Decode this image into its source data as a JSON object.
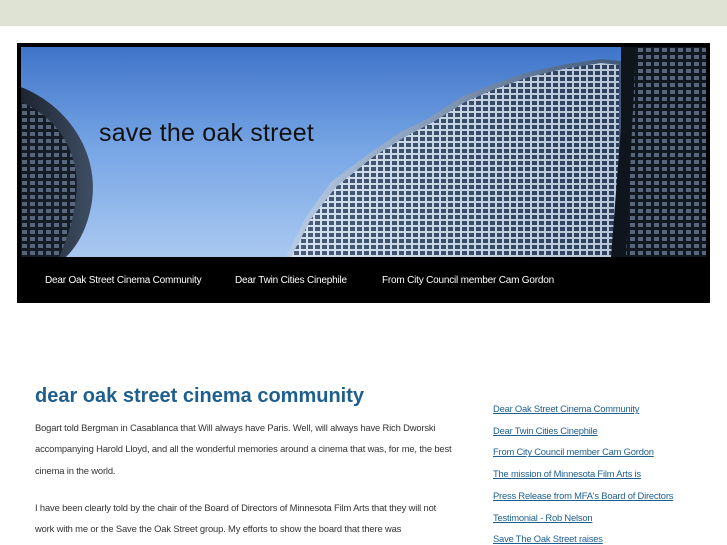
{
  "site": {
    "title": "save the oak street"
  },
  "nav": {
    "items": [
      {
        "label": "Dear Oak Street Cinema Community"
      },
      {
        "label": "Dear Twin Cities Cinephile"
      },
      {
        "label": "From City Council member Cam Gordon"
      }
    ]
  },
  "post": {
    "title": "dear oak street cinema community",
    "paragraphs": [
      "Bogart told Bergman in Casablanca that Will always have Paris. Well, will always have Rich Dworski accompanying Harold Lloyd, and all the wonderful memories around a cinema that was, for me, the best cinema in the world.",
      "I have been clearly told by the chair of the Board of Directors of Minnesota Film Arts that they will not work with me or the Save the Oak Street group. My efforts to show the board that there was"
    ]
  },
  "sidebar": {
    "links": [
      {
        "label": "Dear Oak Street Cinema Community"
      },
      {
        "label": "Dear Twin Cities Cinephile"
      },
      {
        "label": "From City Council member Cam Gordon"
      },
      {
        "label": "The mission of Minnesota Film Arts is"
      },
      {
        "label": "Press Release from MFA's Board of Directors"
      },
      {
        "label": "Testimonial - Rob Nelson"
      },
      {
        "label": "Save The Oak Street raises"
      }
    ]
  },
  "colors": {
    "topbar": "#dfe3d4",
    "link": "#1f5f8f",
    "sky": "#5a8fd8",
    "header_bg": "#000000"
  }
}
